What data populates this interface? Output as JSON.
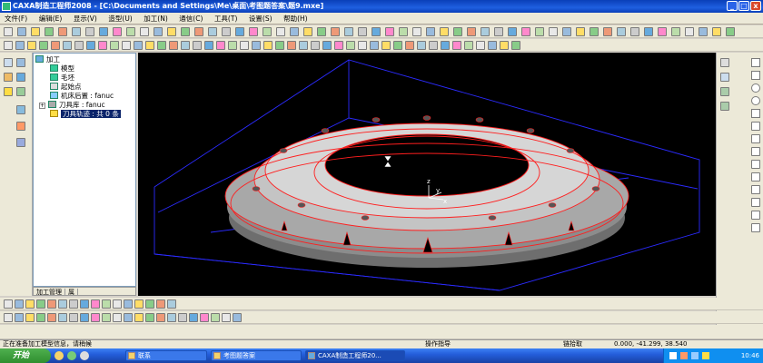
{
  "window": {
    "title": "CAXA制造工程师2008  - [C:\\Documents and Settings\\Me\\桌面\\考图题答案\\题9.mxe]",
    "controls": [
      "_",
      "□",
      "x"
    ]
  },
  "menu": [
    "文件(F)",
    "编辑(E)",
    "显示(V)",
    "造型(U)",
    "加工(N)",
    "通信(C)",
    "工具(T)",
    "设置(S)",
    "帮助(H)"
  ],
  "tree": {
    "root": "加工",
    "items": [
      {
        "label": "模型"
      },
      {
        "label": "毛坯"
      },
      {
        "label": "起始点"
      },
      {
        "label": "机床后置 : fanuc"
      },
      {
        "label": "刀具库 : fanuc"
      },
      {
        "label": "刀具轨迹 : 共 0 条"
      }
    ],
    "tabs": [
      "加工管理",
      "属"
    ]
  },
  "viewport": {
    "axis_labels": [
      "z",
      "y",
      "x"
    ],
    "colors": {
      "background": "#000000",
      "part": "#b4b4b4",
      "toolpath": "#ff1e1e",
      "stock": "#2b2bff"
    }
  },
  "status": {
    "message": "正在准备加工模型信息，请稍候",
    "hint": "操作指导",
    "mode": "链拾取",
    "coords": "0.000, -41.299, 38.540"
  },
  "taskbar": {
    "start": "开始",
    "tasks": [
      "联系",
      "考图题答案",
      "CAXA制造工程师20..."
    ],
    "clock": "10:46"
  }
}
